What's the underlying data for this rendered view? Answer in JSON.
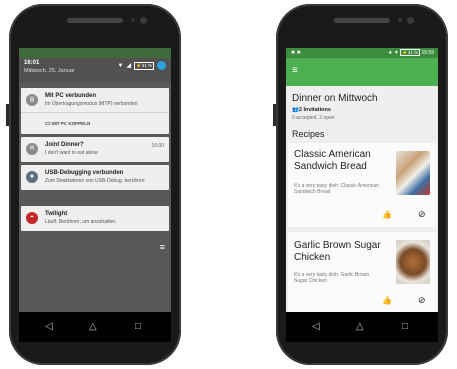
{
  "left_phone": {
    "shade": {
      "time": "16:01",
      "date": "Mittwoch, 25. Januar",
      "battery": "31 %"
    },
    "notifications": [
      {
        "title": "Mit PC verbunden",
        "text": "Im Übertragungsmodus (MTP) verbunden",
        "action": "MIT PC KOPPELN",
        "icon": "usb-icon",
        "color": "#8b8b8b"
      },
      {
        "title": "Joint Dinner?",
        "text": "I don't want to eat alone",
        "time": "16:00",
        "icon": "cutlery-icon",
        "color": "#8b8b8b"
      },
      {
        "title": "USB-Debugging verbunden",
        "text": "Zum Deaktivieren von USB-Debug. berühren",
        "icon": "bug-icon",
        "color": "#5a7281"
      },
      {
        "title": "Twilight",
        "text": "Läuft. Berühren, um anzuhalten.",
        "icon": "twilight-icon",
        "color": "#c62828"
      }
    ]
  },
  "right_phone": {
    "status": {
      "time": "15:59",
      "battery": "31 %"
    },
    "event": {
      "title": "Dinner on Mittwoch",
      "invitations": "2 Invitations",
      "status": "0 accepted, 2 open"
    },
    "recipes_heading": "Recipes",
    "recipes": [
      {
        "title": "Classic American Sandwich Bread",
        "description": "It's a very tasty dish: Classic American Sandwich Bread"
      },
      {
        "title": "Garlic Brown Sugar Chicken",
        "description": "It's a very tasty dish: Garlic Brown Sugar Chicken"
      }
    ]
  }
}
